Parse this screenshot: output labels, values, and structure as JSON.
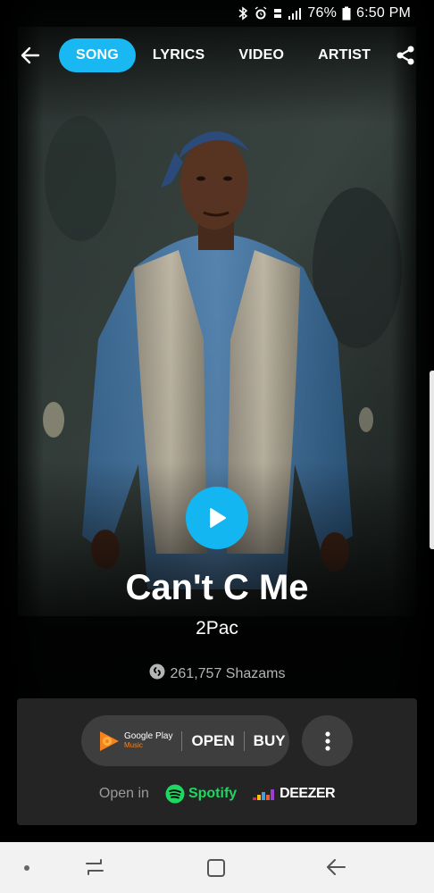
{
  "status_bar": {
    "battery": "76%",
    "time": "6:50 PM",
    "icons": [
      "bluetooth-icon",
      "alarm-icon",
      "lte-icon",
      "signal-icon",
      "battery-icon"
    ]
  },
  "nav": {
    "tabs": [
      {
        "label": "SONG",
        "active": true
      },
      {
        "label": "LYRICS",
        "active": false
      },
      {
        "label": "VIDEO",
        "active": false
      },
      {
        "label": "ARTIST",
        "active": false
      }
    ]
  },
  "song": {
    "title": "Can't C Me",
    "artist": "2Pac",
    "shazams": "261,757 Shazams"
  },
  "provider": {
    "brand_line1": "Google Play",
    "brand_line2": "Music",
    "open_label": "OPEN",
    "buy_label": "BUY",
    "open_in_label": "Open in",
    "spotify_label": "Spotify",
    "deezer_label": "DEEZER"
  },
  "colors": {
    "accent": "#1ab8f2",
    "spotify": "#1ed760",
    "google_play_orange": "#f5811f",
    "card_bg": "#242424"
  }
}
